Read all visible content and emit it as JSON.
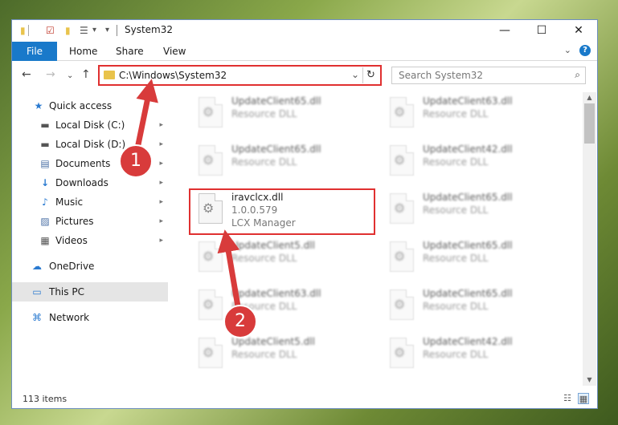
{
  "window": {
    "title": "System32",
    "controls": {
      "minimize": "—",
      "maximize": "☐",
      "close": "✕"
    }
  },
  "quick_access_toolbar": {
    "folder_icon": "folder-icon",
    "properties_icon": "properties-check-icon",
    "new_folder_icon": "new-folder-icon",
    "customize_icon": "customize-toolbar-icon",
    "dropdown": "▾"
  },
  "ribbon": {
    "tabs": [
      "File",
      "Home",
      "Share",
      "View"
    ],
    "expand": "⌄",
    "help": "?"
  },
  "navigation": {
    "back": "←",
    "forward": "→",
    "recent": "⌄",
    "up": "↑"
  },
  "address_bar": {
    "path": "C:\\Windows\\System32",
    "dropdown": "⌄",
    "refresh": "↻"
  },
  "search": {
    "placeholder": "Search System32",
    "icon": "⌕"
  },
  "sidebar": {
    "items": [
      {
        "label": "Quick access",
        "icon": "star-icon",
        "glyph": "★",
        "pinned": false
      },
      {
        "label": "Local Disk (C:)",
        "icon": "drive-icon",
        "glyph": "▬",
        "pinned": true
      },
      {
        "label": "Local Disk (D:)",
        "icon": "drive-icon",
        "glyph": "▬",
        "pinned": true
      },
      {
        "label": "Documents",
        "icon": "documents-icon",
        "glyph": "▤",
        "pinned": true
      },
      {
        "label": "Downloads",
        "icon": "downloads-icon",
        "glyph": "↓",
        "pinned": true
      },
      {
        "label": "Music",
        "icon": "music-icon",
        "glyph": "♪",
        "pinned": true
      },
      {
        "label": "Pictures",
        "icon": "pictures-icon",
        "glyph": "▨",
        "pinned": true
      },
      {
        "label": "Videos",
        "icon": "videos-icon",
        "glyph": "▦",
        "pinned": true
      },
      {
        "label": "OneDrive",
        "icon": "cloud-icon",
        "glyph": "☁",
        "pinned": false
      },
      {
        "label": "This PC",
        "icon": "computer-icon",
        "glyph": "▭",
        "pinned": false
      },
      {
        "label": "Network",
        "icon": "network-icon",
        "glyph": "⌘",
        "pinned": false
      }
    ],
    "pin_glyph": "📌"
  },
  "files": {
    "rows": [
      [
        {
          "name": "UpdateClient65.dll",
          "line2": "Resource DLL",
          "line3": ""
        },
        {
          "name": "UpdateClient63.dll",
          "line2": "Resource DLL",
          "line3": ""
        }
      ],
      [
        {
          "name": "UpdateClient65.dll",
          "line2": "Resource DLL",
          "line3": ""
        },
        {
          "name": "UpdateClient42.dll",
          "line2": "Resource DLL",
          "line3": ""
        }
      ],
      [
        {
          "name": "iravclcx.dll",
          "line2": "1.0.0.579",
          "line3": "LCX Manager"
        },
        {
          "name": "UpdateClient65.dll",
          "line2": "Resource DLL",
          "line3": ""
        }
      ],
      [
        {
          "name": "UpdateClient5.dll",
          "line2": "Resource DLL",
          "line3": ""
        },
        {
          "name": "UpdateClient65.dll",
          "line2": "Resource DLL",
          "line3": ""
        }
      ],
      [
        {
          "name": "UpdateClient63.dll",
          "line2": "Resource DLL",
          "line3": ""
        },
        {
          "name": "UpdateClient65.dll",
          "line2": "Resource DLL",
          "line3": ""
        }
      ],
      [
        {
          "name": "UpdateClient5.dll",
          "line2": "Resource DLL",
          "line3": ""
        },
        {
          "name": "UpdateClient42.dll",
          "line2": "Resource DLL",
          "line3": ""
        }
      ]
    ]
  },
  "status": {
    "item_count": "113 items",
    "details_view_icon": "☷",
    "tiles_view_icon": "▦"
  },
  "annotations": {
    "callout_1": "1",
    "callout_2": "2",
    "color": "#d83b3b"
  }
}
